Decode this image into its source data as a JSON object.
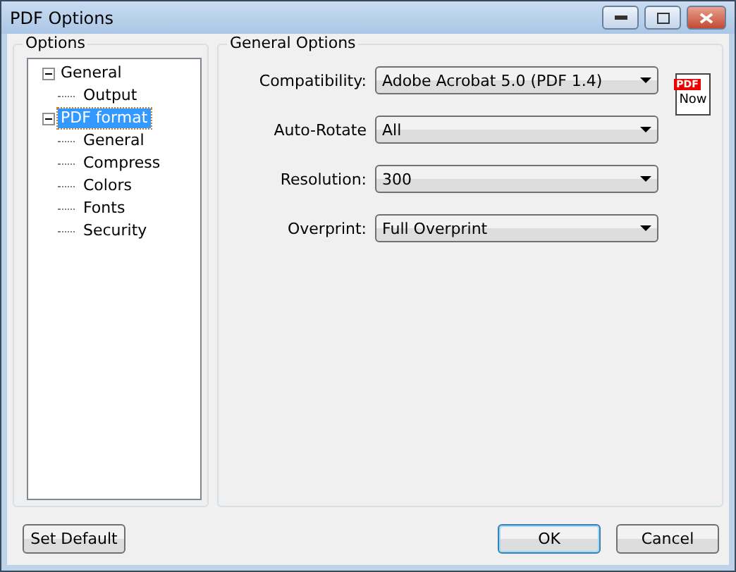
{
  "window": {
    "title": "PDF Options"
  },
  "options_group": {
    "title": "Options",
    "tree": [
      {
        "label": "General",
        "expanded": true,
        "selected": false,
        "children": [
          {
            "label": "Output",
            "selected": false
          }
        ]
      },
      {
        "label": "PDF format",
        "expanded": true,
        "selected": true,
        "children": [
          {
            "label": "General",
            "selected": false
          },
          {
            "label": "Compress",
            "selected": false
          },
          {
            "label": "Colors",
            "selected": false
          },
          {
            "label": "Fonts",
            "selected": false
          },
          {
            "label": "Security",
            "selected": false
          }
        ]
      }
    ]
  },
  "general_group": {
    "title": "General Options",
    "logo": {
      "badge": "PDF",
      "caption": "Now"
    },
    "fields": [
      {
        "label": "Compatibility:",
        "value": "Adobe Acrobat 5.0 (PDF 1.4)"
      },
      {
        "label": "Auto-Rotate",
        "value": "All"
      },
      {
        "label": "Resolution:",
        "value": "300"
      },
      {
        "label": "Overprint:",
        "value": "Full Overprint"
      }
    ]
  },
  "buttons": {
    "left": [
      "Set Default"
    ],
    "right": [
      {
        "label": "OK",
        "default": true
      },
      {
        "label": "Cancel",
        "default": false
      }
    ]
  }
}
